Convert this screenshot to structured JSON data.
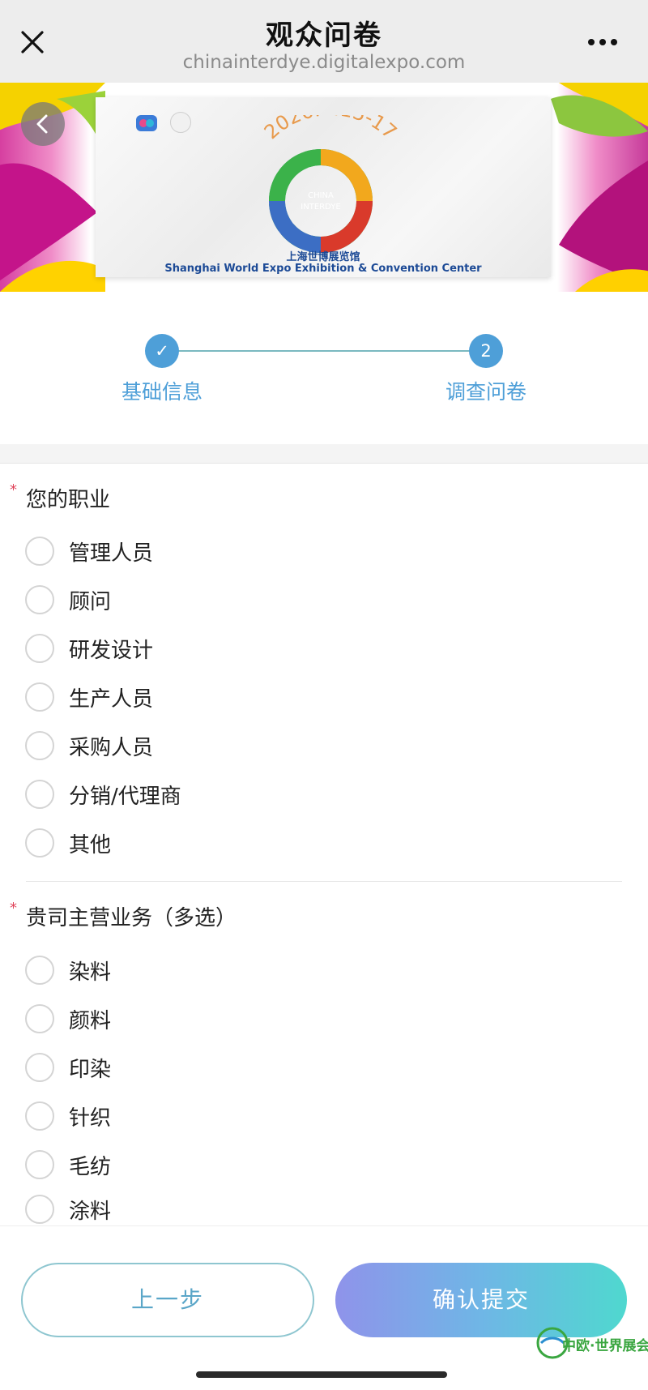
{
  "navbar": {
    "title": "观众问卷",
    "url": "chinainterdye.digitalexpo.com",
    "close_icon": "close-icon",
    "more_icon": "more-dots-icon"
  },
  "banner": {
    "date": "2026.4.15-17",
    "ring_text_line1": "CHINA",
    "ring_text_line2": "INTERDYE",
    "venue_cn": "上海世博展览馆",
    "venue_en": "Shanghai World Expo Exhibition & Convention Center",
    "back_icon": "chevron-left-icon"
  },
  "stepper": {
    "steps": [
      {
        "label": "基础信息",
        "state": "done",
        "marker": "✓"
      },
      {
        "label": "调查问卷",
        "state": "current",
        "marker": "2"
      }
    ],
    "accent": "#4e9fd8"
  },
  "questions": [
    {
      "title": "您的职业",
      "required": true,
      "options": [
        "管理人员",
        "顾问",
        "研发设计",
        "生产人员",
        "采购人员",
        "分销/代理商",
        "其他"
      ]
    },
    {
      "title": "贵司主营业务（多选）",
      "required": true,
      "options": [
        "染料",
        "颜料",
        "印染",
        "针织",
        "毛纺",
        "涂料"
      ]
    }
  ],
  "footer": {
    "prev_label": "上一步",
    "submit_label": "确认提交",
    "watermark": "中欧·世界展会"
  },
  "colors": {
    "required_mark": "#e0445a",
    "prev_border": "#8ec6d0",
    "submit_gradient_start": "#8f93ea",
    "submit_gradient_end": "#4fd8cf"
  }
}
